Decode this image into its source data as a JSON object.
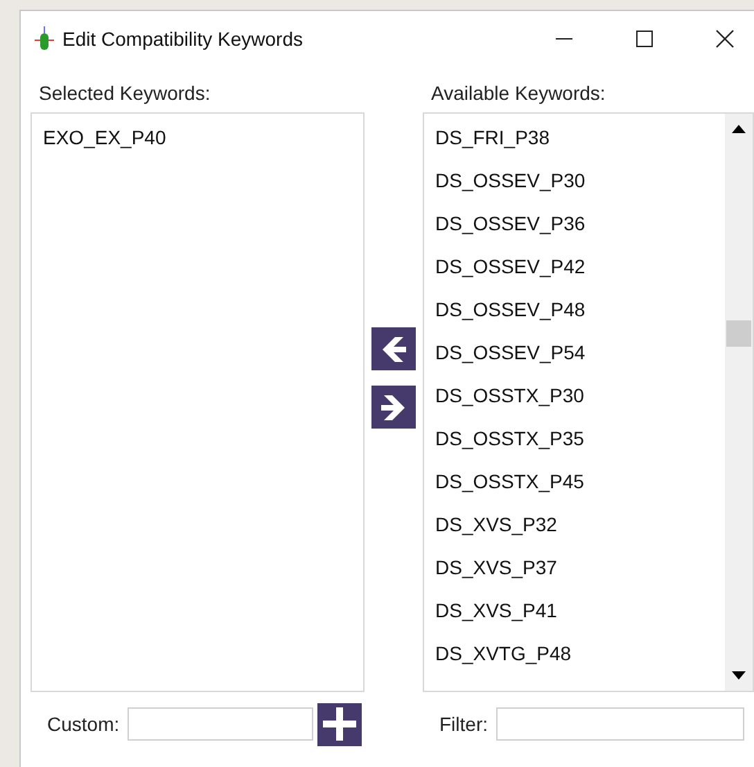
{
  "window": {
    "title": "Edit Compatibility Keywords"
  },
  "selected_keywords": {
    "label": "Selected Keywords:",
    "items": [
      "EXO_EX_P40"
    ]
  },
  "available_keywords": {
    "label": "Available Keywords:",
    "items": [
      "DS_FRI_P38",
      "DS_OSSEV_P30",
      "DS_OSSEV_P36",
      "DS_OSSEV_P42",
      "DS_OSSEV_P48",
      "DS_OSSEV_P54",
      "DS_OSSTX_P30",
      "DS_OSSTX_P35",
      "DS_OSSTX_P45",
      "DS_XVS_P32",
      "DS_XVS_P37",
      "DS_XVS_P41",
      "DS_XVTG_P48"
    ]
  },
  "custom": {
    "label": "Custom:"
  },
  "filter": {
    "label": "Filter:"
  }
}
